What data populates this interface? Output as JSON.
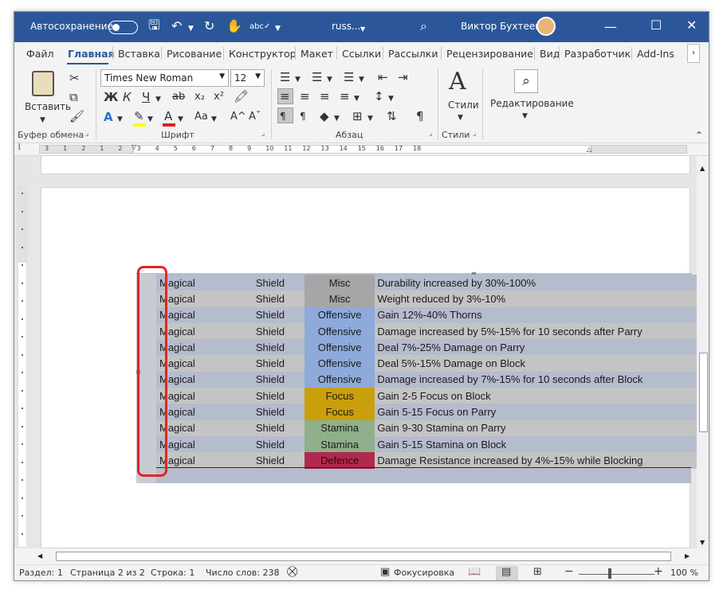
{
  "titlebar": {
    "autosave_label": "Автосохранение",
    "doc_name": "russ...",
    "user_name": "Виктор Бухтеев",
    "color": "#2b579a"
  },
  "tabs": [
    "Файл",
    "Главная",
    "Вставка",
    "Рисование",
    "Конструктор",
    "Макет",
    "Ссылки",
    "Рассылки",
    "Рецензирование",
    "Вид",
    "Разработчик",
    "Add-Ins"
  ],
  "ribbon": {
    "paste_label": "Вставить",
    "font_name": "Times New Roman",
    "font_size": "12",
    "styles_label": "Стили",
    "editing_label": "Редактирование",
    "groups": {
      "clipboard": "Буфер обмена",
      "font": "Шрифт",
      "paragraph": "Абзац",
      "styles": "Стили"
    },
    "font_buttons": {
      "bold": "Ж",
      "italic": "К",
      "underline": "Ч",
      "strike": "ab",
      "subscript": "x₂",
      "superscript": "x²",
      "grow": "A^",
      "shrink": "Aˇ",
      "case": "Aa"
    }
  },
  "ruler_marks": [
    "3",
    "1",
    "2",
    "1",
    "2",
    "3",
    "4",
    "5",
    "6",
    "7",
    "8",
    "9",
    "10",
    "11",
    "12",
    "13",
    "14",
    "15",
    "16",
    "17",
    "18"
  ],
  "table": {
    "rows": [
      {
        "type": "Magical",
        "item": "Shield",
        "category": "Misc",
        "desc": "Durability increased by 30%-100%",
        "cat_color": "#a6a6a6"
      },
      {
        "type": "Magical",
        "item": "Shield",
        "category": "Misc",
        "desc": "Weight reduced by 3%-10%",
        "cat_color": "#a6a6a6"
      },
      {
        "type": "Magical",
        "item": "Shield",
        "category": "Offensive",
        "desc": "Gain 12%-40% Thorns",
        "cat_color": "#8eaadb"
      },
      {
        "type": "Magical",
        "item": "Shield",
        "category": "Offensive",
        "desc": "Damage increased by 5%-15% for 10 seconds after Parry",
        "cat_color": "#8eaadb"
      },
      {
        "type": "Magical",
        "item": "Shield",
        "category": "Offensive",
        "desc": "Deal 7%-25% Damage on Parry",
        "cat_color": "#8eaadb"
      },
      {
        "type": "Magical",
        "item": "Shield",
        "category": "Offensive",
        "desc": "Deal 5%-15% Damage on Block",
        "cat_color": "#8eaadb"
      },
      {
        "type": "Magical",
        "item": "Shield",
        "category": "Offensive",
        "desc": "Damage increased by 7%-15% for 10 seconds after Block",
        "cat_color": "#8eaadb"
      },
      {
        "type": "Magical",
        "item": "Shield",
        "category": "Focus",
        "desc": "Gain 2-5 Focus on Block",
        "cat_color": "#c9a00c"
      },
      {
        "type": "Magical",
        "item": "Shield",
        "category": "Focus",
        "desc": "Gain 5-15 Focus on Parry",
        "cat_color": "#c9a00c"
      },
      {
        "type": "Magical",
        "item": "Shield",
        "category": "Stamina",
        "desc": "Gain 9-30 Stamina on Parry",
        "cat_color": "#8fb08a"
      },
      {
        "type": "Magical",
        "item": "Shield",
        "category": "Stamina",
        "desc": "Gain 5-15 Stamina on Block",
        "cat_color": "#8fb08a"
      },
      {
        "type": "Magical",
        "item": "Shield",
        "category": "Defence",
        "desc": "Damage Resistance increased by 4%-15% while Blocking",
        "cat_color": "#b02a50"
      }
    ]
  },
  "status": {
    "section": "Раздел: 1",
    "page": "Страница 2 из 2",
    "line": "Строка: 1",
    "words": "Число слов: 238",
    "focus": "Фокусировка",
    "zoom": "100 %"
  }
}
